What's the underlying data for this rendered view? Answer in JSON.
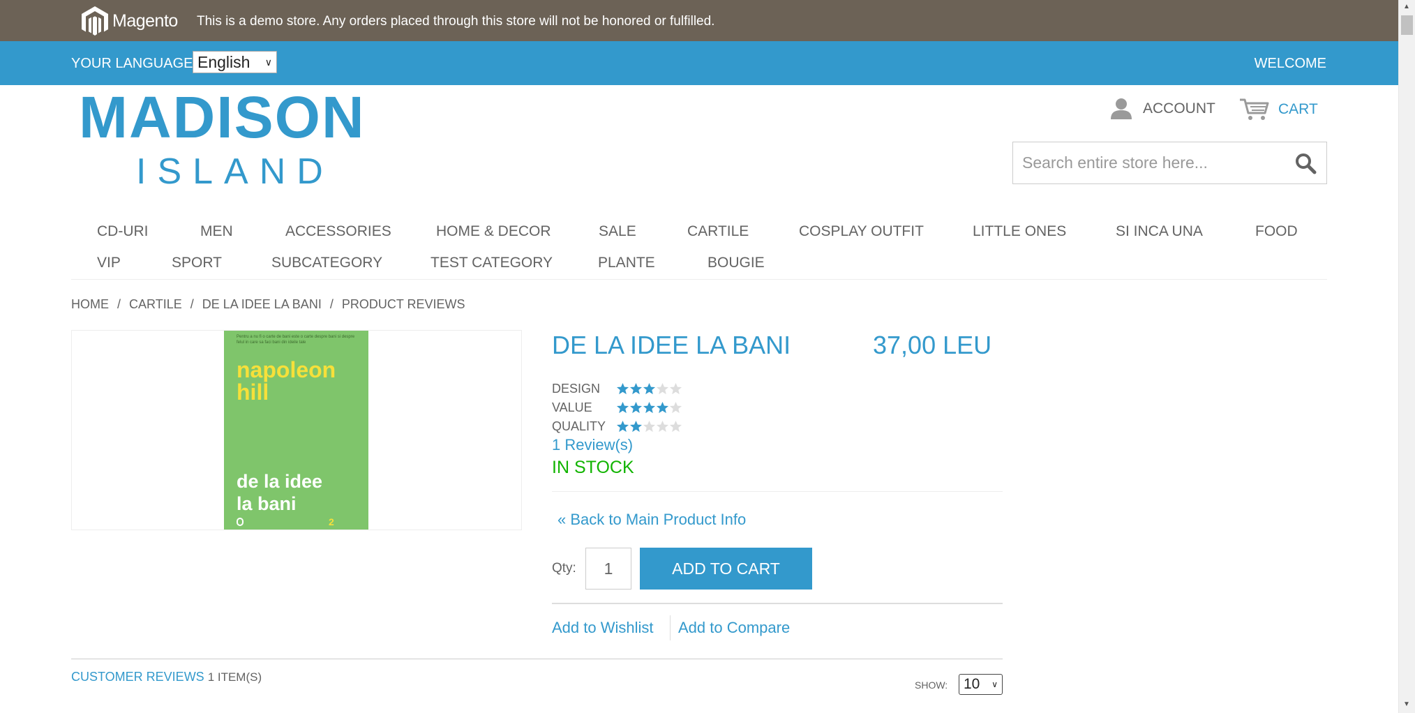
{
  "demo_notice": {
    "logo_text": "Magento",
    "text": "This is a demo store. Any orders placed through this store will not be honored or fulfilled."
  },
  "top_bar": {
    "language_label": "YOUR LANGUAGE:",
    "language_value": "English",
    "welcome": "WELCOME"
  },
  "logo": {
    "main": "MADISON",
    "sub": "ISLAND"
  },
  "header": {
    "account_label": "ACCOUNT",
    "cart_label": "CART",
    "search_placeholder": "Search entire store here..."
  },
  "nav": {
    "items": [
      "CD-URI",
      "MEN",
      "ACCESSORIES",
      "HOME & DECOR",
      "SALE",
      "CARTILE",
      "COSPLAY OUTFIT",
      "LITTLE ONES",
      "SI INCA UNA",
      "FOOD",
      "VIP",
      "SPORT",
      "SUBCATEGORY",
      "TEST CATEGORY",
      "PLANTE",
      "BOUGIE"
    ]
  },
  "breadcrumb": {
    "items": [
      "HOME",
      "CARTILE",
      "DE LA IDEE LA BANI",
      "PRODUCT REVIEWS"
    ],
    "separator": "/"
  },
  "book_cover": {
    "top_text": "Pentru a nu fi o carte de bani este o carte despre bani si despre felul in care sa faci bani din ideile tale",
    "author_line1": "napoleon",
    "author_line2": "hill",
    "title_line1": "de la idee",
    "title_line2": "la bani",
    "corner_mark": "2"
  },
  "product": {
    "name": "DE LA IDEE LA BANI",
    "price": "37,00 LEU",
    "ratings": [
      {
        "label": "DESIGN",
        "stars": 3,
        "max": 5
      },
      {
        "label": "VALUE",
        "stars": 4,
        "max": 5
      },
      {
        "label": "QUALITY",
        "stars": 2,
        "max": 5
      }
    ],
    "reviews_link": "1 Review(s)",
    "stock": "IN STOCK",
    "back_link": "« Back to Main Product Info",
    "qty_label": "Qty:",
    "qty_value": "1",
    "add_to_cart": "ADD TO CART",
    "wishlist": "Add to Wishlist",
    "compare": "Add to Compare"
  },
  "customer_reviews": {
    "title": "CUSTOMER REVIEWS",
    "count": "1 ITEM(S)",
    "show_label": "SHOW:",
    "show_value": "10"
  },
  "colors": {
    "brand_blue": "#3399cc",
    "demo_bar": "#6c6256",
    "in_stock": "#11b400",
    "star_filled": "#3399cc",
    "star_empty": "#dddddd"
  }
}
